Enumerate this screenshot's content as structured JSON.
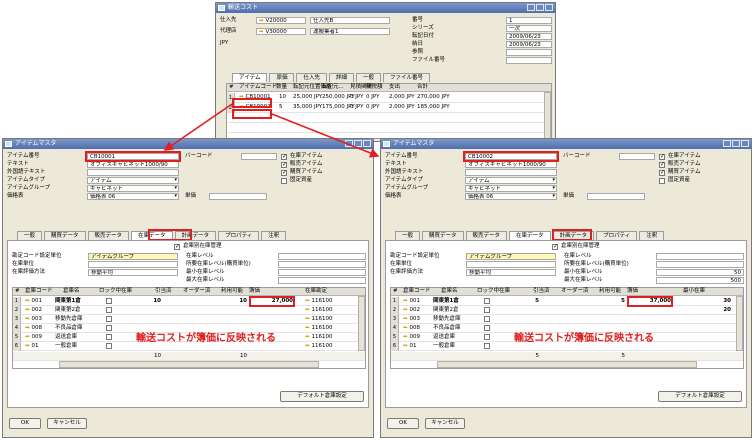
{
  "top": {
    "title": "輸送コスト",
    "vendor_label": "仕入先",
    "vendor_code": "V20000",
    "vendor_name": "仕入先B",
    "agent_label": "代理店",
    "agent_code": "V30000",
    "agent_name": "運搬業者1",
    "currency": "JPY",
    "right_labels": [
      "番号",
      "シリーズ",
      "転記日付",
      "納日",
      "参照",
      "ファイル番号"
    ],
    "right_values": [
      "1",
      "一次",
      "2009/06/23",
      "2009/06/23",
      "",
      ""
    ],
    "tabs": [
      "アイテム",
      "原価",
      "仕入先",
      "詳細",
      "一般",
      "ファイル番号"
    ],
    "grid_headers": [
      "#",
      "アイテムコード",
      "数量",
      "転記元位置価格",
      "転記元...",
      "見積関税",
      "関税額",
      "支出",
      "合計"
    ],
    "rows": [
      {
        "n": "1",
        "code": "CB10001",
        "qty": "10",
        "price": "25,000 JPY",
        "total_src": "250,000 JPY",
        "est": "0 JPY",
        "duty": "0 JPY",
        "exp": "2,000 JPY",
        "sum": "270,000 JPY"
      },
      {
        "n": "2",
        "code": "CB10002",
        "qty": "5",
        "price": "35,000 JPY",
        "total_src": "175,000 JPY",
        "est": "0 JPY",
        "duty": "0 JPY",
        "exp": "2,000 JPY",
        "sum": "185,000 JPY"
      }
    ]
  },
  "left": {
    "title": "アイテムマスタ",
    "labels": [
      "アイテム番号",
      "テキスト",
      "外国語テキスト",
      "アイテムタイプ",
      "アイテムグループ",
      "価格表"
    ],
    "item_no": "CB10001",
    "text": "オフィスキャビネット1000/90",
    "type": "アイテム",
    "group": "キャビネット",
    "price_list": "価格表 06",
    "unit_label": "単価",
    "barcode_label": "バーコード",
    "checks": [
      "在庫アイテム",
      "販売アイテム",
      "購買アイテム",
      "固定資産"
    ],
    "tabs": [
      "一般",
      "購買データ",
      "販売データ",
      "在庫データ",
      "計画データ",
      "プロパティ",
      "注釈"
    ],
    "manage_wh": "倉庫別在庫管理",
    "inv_labels": [
      "勘定コード設定単位",
      "在庫単位",
      "在庫評価方法"
    ],
    "inv_values": [
      "アイテムグループ",
      "",
      "移動平均"
    ],
    "lvl_labels": [
      "在庫レベル",
      "所要在庫レベル(購買単位)",
      "最小在庫レベル",
      "最大在庫レベル"
    ],
    "lvl_values": [
      "",
      "",
      "",
      ""
    ],
    "grid_headers": [
      "#",
      "倉庫コード",
      "倉庫名",
      "ロック中",
      "在庫",
      "引当済",
      "オーダー済",
      "利用可能",
      "簿価",
      "在庫勘定"
    ],
    "rows": [
      {
        "n": "1",
        "code": "001",
        "name": "関東第1倉",
        "stock": "10",
        "avail": "10",
        "cost": "27,000",
        "acct": "116100"
      },
      {
        "n": "2",
        "code": "002",
        "name": "関東第2倉",
        "stock": "",
        "avail": "",
        "cost": "",
        "acct": "116100"
      },
      {
        "n": "3",
        "code": "003",
        "name": "移動先倉庫",
        "stock": "",
        "avail": "",
        "cost": "",
        "acct": "116100"
      },
      {
        "n": "4",
        "code": "008",
        "name": "不良品倉庫",
        "stock": "",
        "avail": "",
        "cost": "",
        "acct": "116100"
      },
      {
        "n": "5",
        "code": "009",
        "name": "返送倉庫",
        "stock": "",
        "avail": "",
        "cost": "",
        "acct": "116100"
      },
      {
        "n": "6",
        "code": "01",
        "name": "一般倉庫",
        "stock": "",
        "avail": "",
        "cost": "",
        "acct": "116100"
      }
    ],
    "total_stock": "10",
    "total_avail": "10",
    "note": "輸送コストが簿価に反映される",
    "default_wh": "デフォルト倉庫設定",
    "ok": "OK",
    "cancel": "キャンセル"
  },
  "right": {
    "title": "アイテムマスタ",
    "labels": [
      "アイテム番号",
      "テキスト",
      "外国語テキスト",
      "アイテムタイプ",
      "アイテムグループ",
      "価格表"
    ],
    "item_no": "CB10002",
    "text": "オフィスキャビネット1000/90",
    "type": "アイテム",
    "group": "キャビネット",
    "price_list": "価格表 06",
    "unit_label": "単価",
    "barcode_label": "バーコード",
    "checks": [
      "在庫アイテム",
      "販売アイテム",
      "購買アイテム",
      "固定資産"
    ],
    "tabs": [
      "一般",
      "購買データ",
      "販売データ",
      "在庫データ",
      "計画データ",
      "プロパティ",
      "注釈"
    ],
    "manage_wh": "倉庫別在庫管理",
    "inv_labels": [
      "勘定コード設定単位",
      "在庫単位",
      "在庫評価方法"
    ],
    "inv_values": [
      "アイテムグループ",
      "",
      "移動平均"
    ],
    "lvl_labels": [
      "在庫レベル",
      "所要在庫レベル(購買単位)",
      "最小在庫レベル",
      "最大在庫レベル"
    ],
    "lvl_values": [
      "",
      "",
      "50",
      "500"
    ],
    "grid_headers": [
      "#",
      "倉庫コード",
      "倉庫名",
      "ロック中",
      "在庫",
      "引当済",
      "オーダー済",
      "利用可能",
      "簿価",
      "最小在庫"
    ],
    "rows": [
      {
        "n": "1",
        "code": "001",
        "name": "関東第1倉",
        "stock": "5",
        "avail": "5",
        "cost": "37,000",
        "acct": "30"
      },
      {
        "n": "2",
        "code": "002",
        "name": "関東第2倉",
        "stock": "",
        "avail": "",
        "cost": "",
        "acct": "20"
      },
      {
        "n": "3",
        "code": "003",
        "name": "移動先倉庫",
        "stock": "",
        "avail": "",
        "cost": "",
        "acct": ""
      },
      {
        "n": "4",
        "code": "008",
        "name": "不良品倉庫",
        "stock": "",
        "avail": "",
        "cost": "",
        "acct": ""
      },
      {
        "n": "5",
        "code": "009",
        "name": "返送倉庫",
        "stock": "",
        "avail": "",
        "cost": "",
        "acct": ""
      },
      {
        "n": "6",
        "code": "01",
        "name": "一般倉庫",
        "stock": "",
        "avail": "",
        "cost": "",
        "acct": ""
      }
    ],
    "total_stock": "5",
    "total_avail": "5",
    "note": "輸送コストが簿価に反映される",
    "default_wh": "デフォルト倉庫設定",
    "ok": "OK",
    "cancel": "キャンセル"
  },
  "colors": {
    "title_bar": "#5a78b5",
    "highlight": "#e02020",
    "field_yellow": "#fdf6b5",
    "window_bg": "#ece9d8",
    "arrow": "#e1a200"
  }
}
